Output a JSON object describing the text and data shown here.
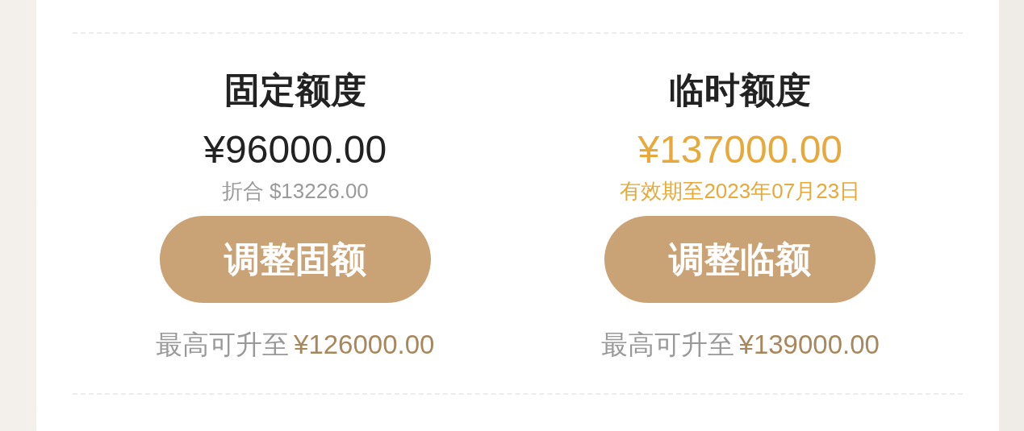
{
  "columns": [
    {
      "title": "固定额度",
      "amount": {
        "text": "¥96000.00",
        "color": "#222222"
      },
      "note": {
        "text": "折合 $13226.00",
        "color": "#9a9a9a"
      },
      "button": "调整固额",
      "limit_label": "最高可升至",
      "limit_value": "¥126000.00"
    },
    {
      "title": "临时额度",
      "amount": {
        "text": "¥137000.00",
        "color": "#e6a93a"
      },
      "note": {
        "text": "有效期至2023年07月23日",
        "color": "#e6a93a"
      },
      "button": "调整临额",
      "limit_label": "最高可升至",
      "limit_value": "¥139000.00"
    }
  ]
}
